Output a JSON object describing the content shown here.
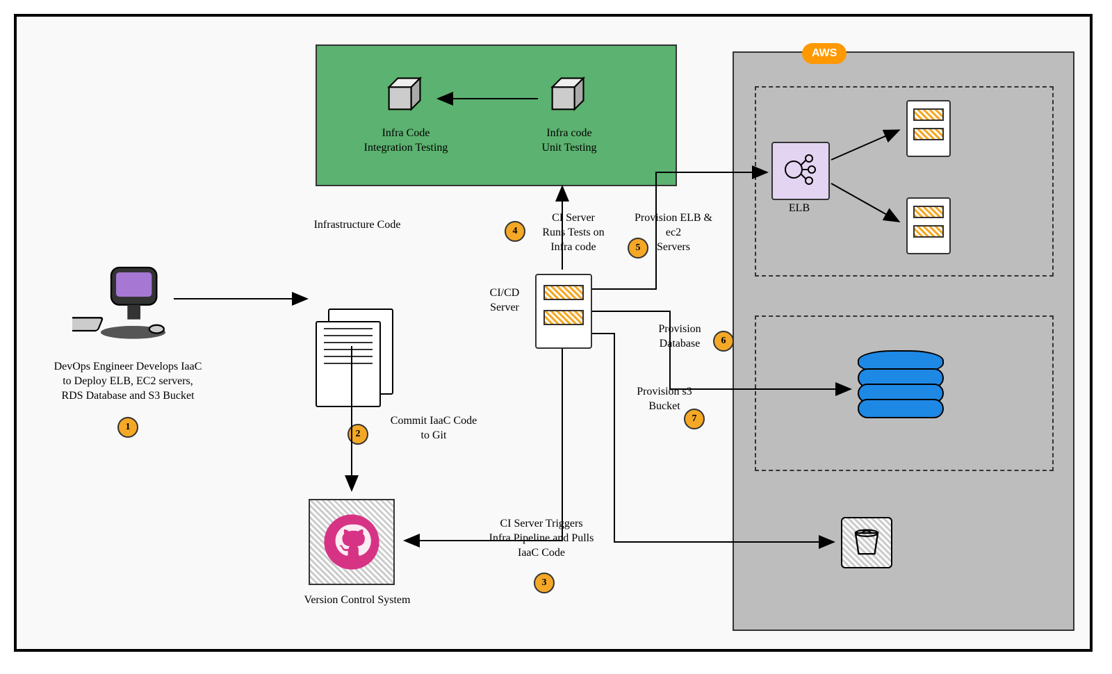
{
  "aws_label": "AWS",
  "elb_label": "ELB",
  "nodes": {
    "engineer": "DevOps Engineer Develops IaaC\nto Deploy ELB, EC2 servers,\nRDS Database and S3 Bucket",
    "infra_code": "Infrastructure Code",
    "commit": "Commit IaaC Code\nto Git",
    "vcs": "Version Control System",
    "ci_trigger": "CI Server Triggers\nInfra Pipeline and Pulls\nIaaC Code",
    "cicd": "CI/CD\nServer",
    "ci_tests": "CI Server\nRuns Tests on\nInfra code",
    "integration": "Infra Code\nIntegration Testing",
    "unit": "Infra code\nUnit Testing",
    "prov_elb": "Provision ELB &\nec2\nServers",
    "prov_db": "Provision\nDatabase",
    "prov_s3": "Provision s3\nBucket"
  },
  "steps": {
    "s1": "1",
    "s2": "2",
    "s3": "3",
    "s4": "4",
    "s5": "5",
    "s6": "6",
    "s7": "7"
  }
}
